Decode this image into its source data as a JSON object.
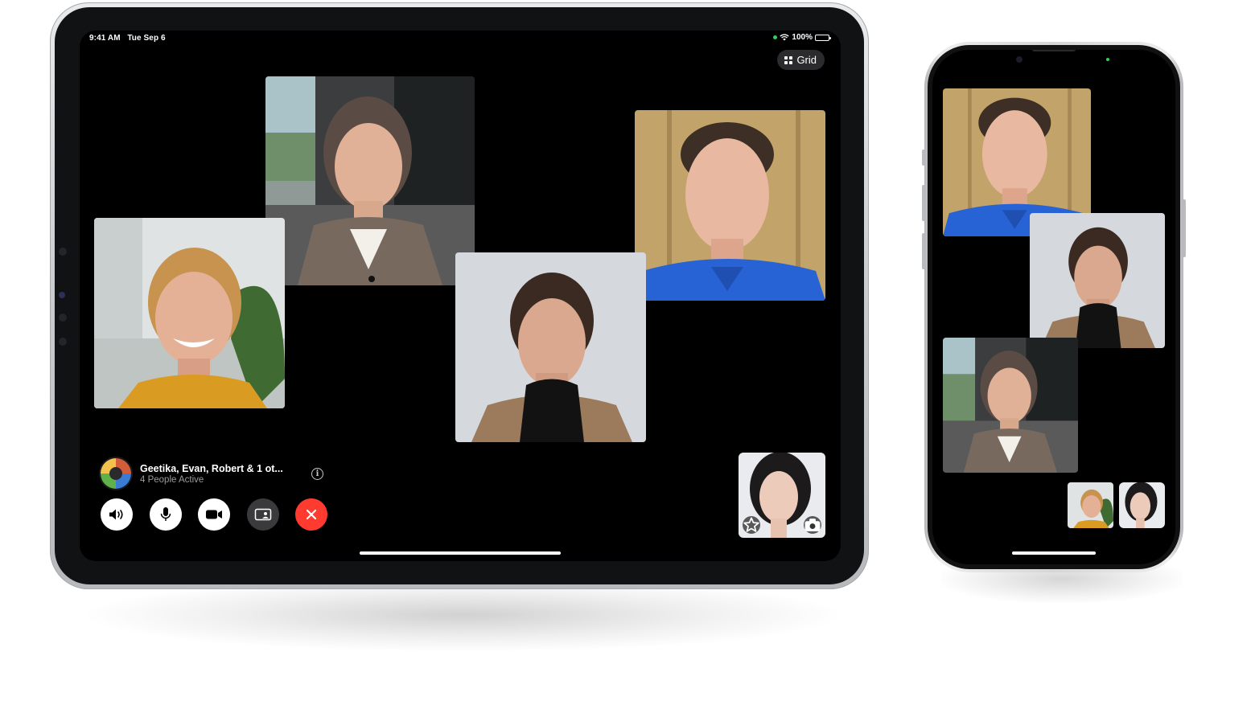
{
  "ipad": {
    "status_bar": {
      "time": "9:41 AM",
      "date": "Tue Sep 6",
      "battery": "100%"
    },
    "layout_button": {
      "label": "Grid",
      "icon": "grid-icon"
    },
    "call_info": {
      "title": "Geetika, Evan, Robert & 1 ot...",
      "subtitle": "4 People Active",
      "info_icon_glyph": "i"
    },
    "controls": [
      {
        "name": "speaker-button",
        "icon": "speaker-icon"
      },
      {
        "name": "mute-button",
        "icon": "microphone-icon"
      },
      {
        "name": "camera-button",
        "icon": "video-camera-icon"
      },
      {
        "name": "shareplay-button",
        "icon": "shareplay-icon"
      },
      {
        "name": "end-call-button",
        "icon": "close-icon"
      }
    ],
    "self_view_icons": [
      "effects-star-icon",
      "camera-flip-icon"
    ]
  },
  "colors": {
    "end_call_red": "#ff3b30",
    "control_white": "#ffffff",
    "control_dark": "#3a3a3c",
    "status_green": "#30d158",
    "screen_black": "#000000"
  }
}
